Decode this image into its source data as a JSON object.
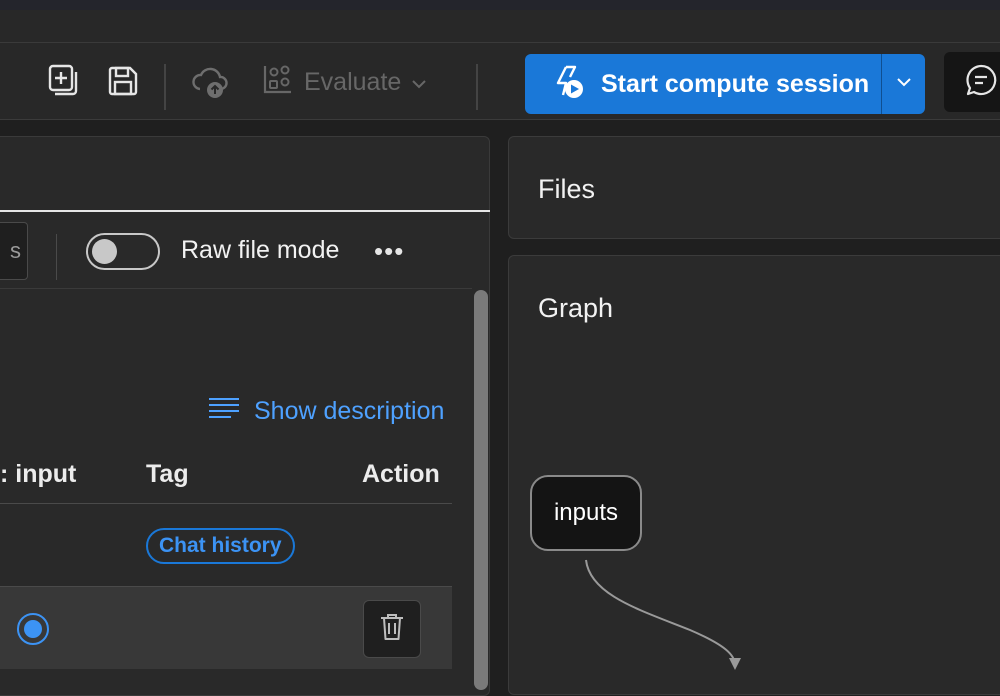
{
  "toolbar": {
    "evaluate_label": "Evaluate",
    "start_label": "Start compute session"
  },
  "left_panel": {
    "partial_button_text": "s",
    "raw_file_mode_label": "Raw file mode",
    "raw_file_mode_on": false,
    "more_label": "•••",
    "show_description_label": "Show description",
    "table": {
      "headers": [
        ": input",
        "Tag",
        "Action"
      ],
      "rows": [
        {
          "tag": "Chat history"
        }
      ]
    }
  },
  "right": {
    "files_title": "Files",
    "graph_title": "Graph",
    "graph_nodes": [
      "inputs"
    ]
  },
  "colors": {
    "accent": "#1a78d8",
    "link": "#4ea1ff",
    "background": "#1f1f1f",
    "panel": "#292929"
  },
  "icons": [
    "add-file-icon",
    "save-icon",
    "cloud-upload-icon",
    "evaluate-icon",
    "chevron-down-icon",
    "flash-play-icon",
    "chat-icon",
    "description-lines-icon",
    "trash-icon"
  ]
}
